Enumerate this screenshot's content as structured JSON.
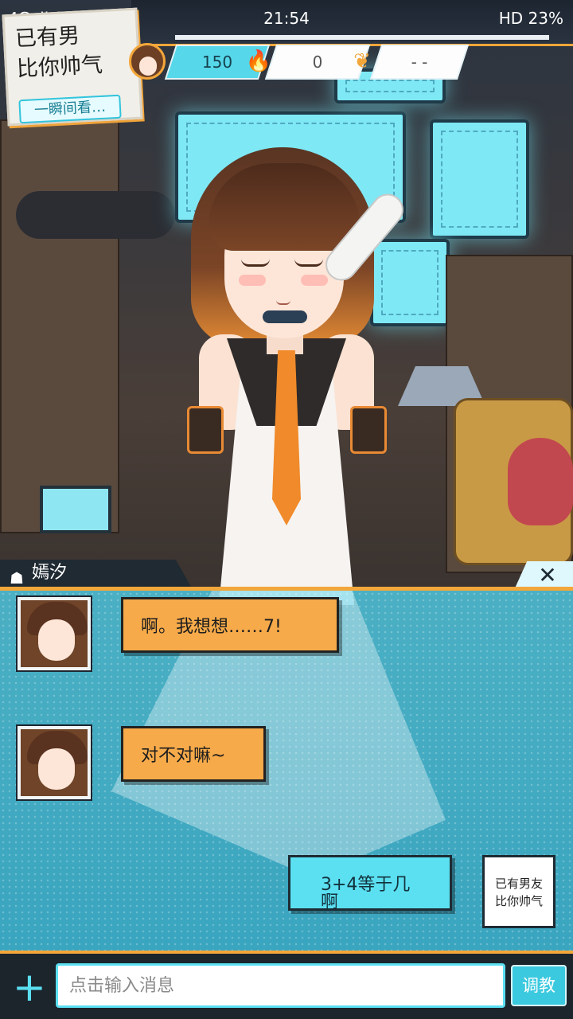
{
  "status_bar": {
    "left": "4G ıll 2.5K/s",
    "time": "21:54",
    "right": "HD 23%"
  },
  "promo": {
    "line1": "已有男",
    "line2": "比你帅气",
    "tag": "一瞬间看…"
  },
  "stats": {
    "affection": "150",
    "fire": "0",
    "wing": "- -"
  },
  "character": {
    "name": "嫣汐"
  },
  "messages": [
    {
      "from": "character",
      "text": "啊。我想想……7!"
    },
    {
      "from": "character",
      "text": "对不对嘛~"
    },
    {
      "from": "user",
      "text": "3+4等于几啊",
      "avatar_line1": "已有男友",
      "avatar_line2": "比你帅气"
    }
  ],
  "input": {
    "placeholder": "点击输入消息",
    "teach_label": "调教",
    "plus_label": "+"
  },
  "close_label": "✕",
  "colors": {
    "accent_orange": "#f3a63a",
    "accent_cyan": "#5be0f2",
    "bubble_orange": "#f6aa4a"
  },
  "icons": [
    "heart-avatar-icon",
    "fire-icon",
    "wing-icon",
    "hair-icon",
    "close-icon",
    "plus-icon"
  ]
}
